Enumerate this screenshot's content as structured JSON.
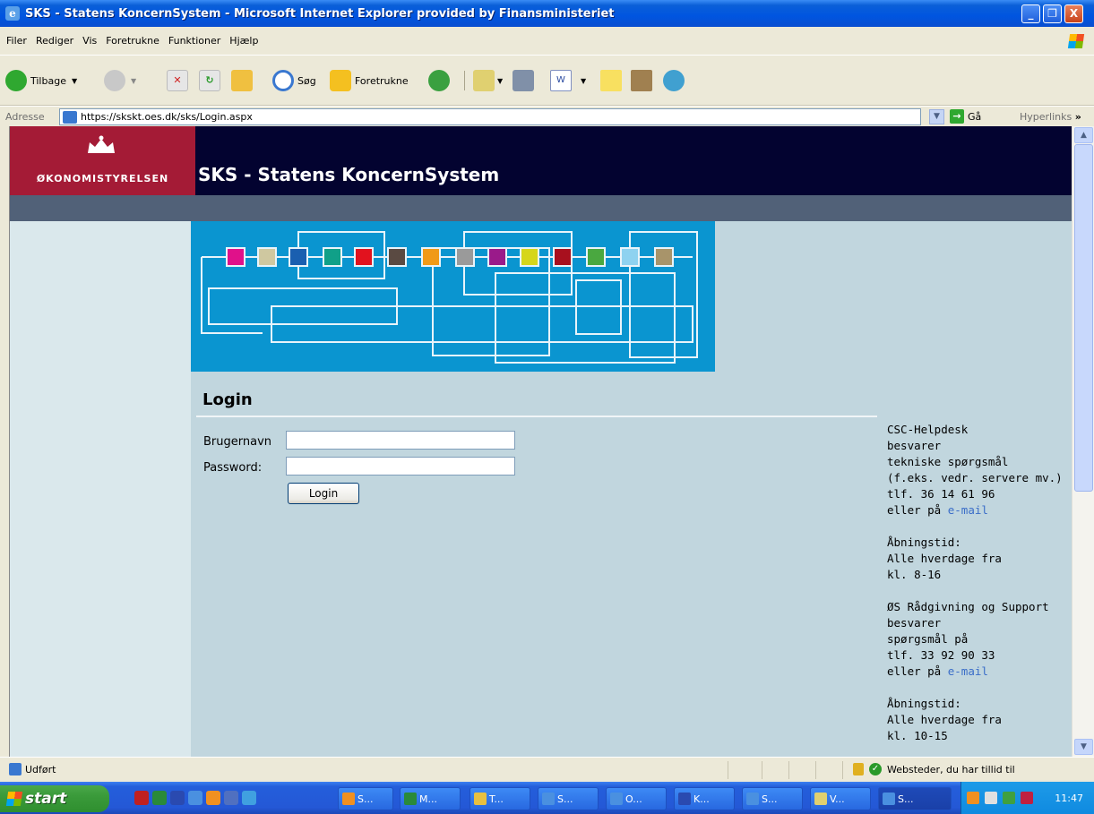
{
  "window": {
    "title": "SKS - Statens KoncernSystem - Microsoft Internet Explorer provided by Finansministeriet",
    "minimize_label": "_",
    "maximize_label": "❐",
    "close_label": "X"
  },
  "menu": [
    "Filer",
    "Rediger",
    "Vis",
    "Foretrukne",
    "Funktioner",
    "Hjælp"
  ],
  "toolbar": {
    "back_label": "Tilbage",
    "search_label": "Søg",
    "favorites_label": "Foretrukne",
    "icons": [
      "back-icon",
      "forward-icon",
      "stop-icon",
      "refresh-icon",
      "home-icon",
      "search-icon",
      "favorites-icon",
      "history-icon",
      "mail-icon",
      "print-icon",
      "word-icon",
      "notes-icon",
      "research-icon",
      "messenger-icon"
    ]
  },
  "address": {
    "label": "Adresse",
    "url": "https://skskt.oes.dk/sks/Login.aspx",
    "go_label": "Gå",
    "links_label": "Hyperlinks"
  },
  "page": {
    "logo_text": "ØKONOMISTYRELSEN",
    "app_title": "SKS - Statens KoncernSystem",
    "login_heading": "Login",
    "username_label": "Brugernavn",
    "password_label": "Password:",
    "username_value": "",
    "password_value": "",
    "login_button": "Login",
    "colors": {
      "header_bg": "#030330",
      "logo_bg": "#a41b36",
      "subbar_bg": "#516178",
      "banner_bg": "#0a95d0",
      "content_bg": "#c1d6de"
    }
  },
  "sidebar_info": {
    "csc": {
      "lines": [
        "CSC-Helpdesk",
        "besvarer",
        "tekniske spørgsmål",
        "(f.eks. vedr. servere mv.)",
        "tlf. 36 14 61 96"
      ],
      "email_prefix": "eller på",
      "email_link": "e-mail"
    },
    "csc_hours": [
      "Åbningstid:",
      "Alle hverdage fra",
      "kl. 8-16"
    ],
    "os": {
      "lines": [
        "ØS Rådgivning og Support",
        "besvarer",
        "spørgsmål på",
        "tlf. 33 92 90 33"
      ],
      "email_prefix": "eller på",
      "email_link": "e-mail"
    },
    "os_hours": [
      "Åbningstid:",
      "Alle hverdage fra",
      "kl. 10-15"
    ]
  },
  "statusbar": {
    "status": "Udført",
    "zone": "Websteder, du har tillid til"
  },
  "taskbar": {
    "start_label": "start",
    "tasks": [
      "S...",
      "M...",
      "T...",
      "S...",
      "O...",
      "K...",
      "S...",
      "V...",
      "S..."
    ],
    "clock": "11:47"
  }
}
